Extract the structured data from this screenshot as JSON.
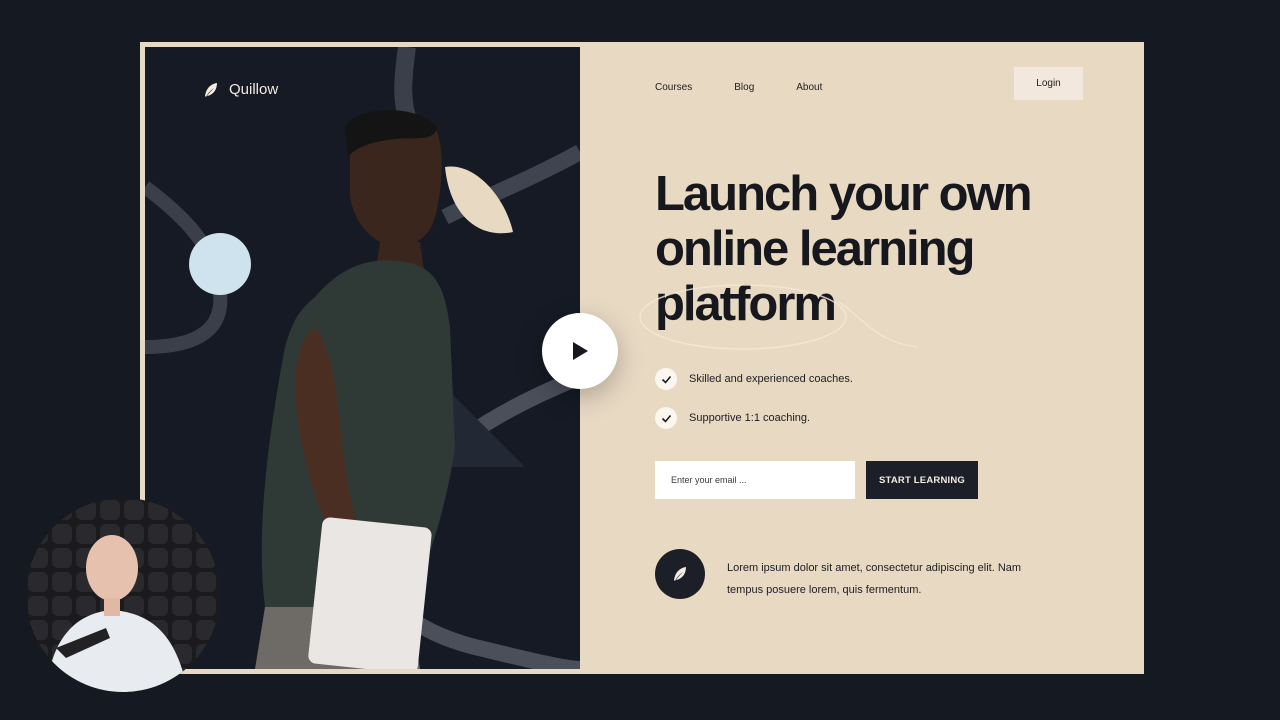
{
  "brand": {
    "name": "Quillow",
    "icon": "feather-icon"
  },
  "nav": {
    "items": [
      {
        "label": "Courses"
      },
      {
        "label": "Blog"
      },
      {
        "label": "About"
      }
    ],
    "login_label": "Login"
  },
  "hero": {
    "headline": "Launch your own online learning platform",
    "features": [
      {
        "icon": "check-icon",
        "text": "Skilled and experienced coaches."
      },
      {
        "icon": "check-icon",
        "text": "Supportive 1:1 coaching."
      }
    ],
    "email_placeholder": "Enter your email ...",
    "cta_label": "START LEARNING",
    "play_icon": "play-icon"
  },
  "testimonial": {
    "icon": "feather-icon",
    "text": "Lorem ipsum dolor sit amet, consectetur adipiscing elit. Nam tempus posuere lorem, quis fermentum."
  },
  "colors": {
    "page_bg": "#151922",
    "panel_bg": "#e8d9c3",
    "dark": "#1c1f27",
    "accent_light_blue": "#cfe3ef"
  }
}
